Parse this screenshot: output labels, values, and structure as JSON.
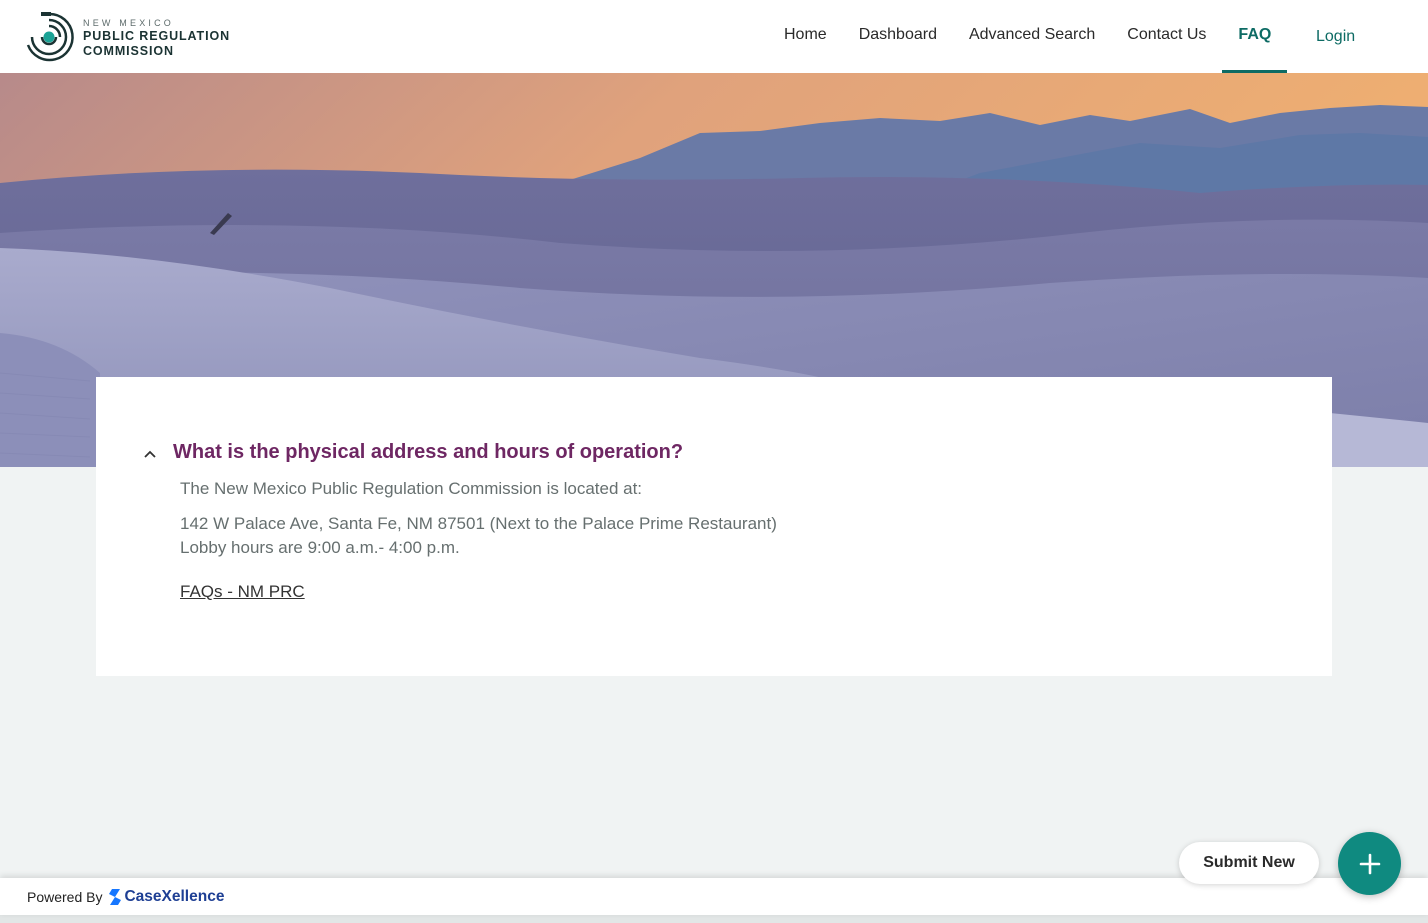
{
  "brand": {
    "line1": "NEW MEXICO",
    "line2": "PUBLIC REGULATION",
    "line3": "COMMISSION"
  },
  "nav": {
    "items": [
      {
        "label": "Home"
      },
      {
        "label": "Dashboard"
      },
      {
        "label": "Advanced Search"
      },
      {
        "label": "Contact Us"
      },
      {
        "label": "FAQ"
      }
    ],
    "active": "FAQ",
    "login": "Login"
  },
  "faq": {
    "question": "What is the physical address and hours of operation?",
    "answer": {
      "intro": "The New Mexico Public Regulation Commission is located at:",
      "address": "142 W Palace Ave, Santa Fe, NM 87501 (Next to the Palace Prime Restaurant)",
      "hours": "Lobby hours are 9:00 a.m.- 4:00 p.m."
    },
    "link": "FAQs - NM PRC",
    "expanded": true
  },
  "footer": {
    "powered_by": "Powered By",
    "vendor": "CaseXellence"
  },
  "actions": {
    "submit_new": "Submit New"
  },
  "colors": {
    "accent": "#0d6b64",
    "question": "#6e2763",
    "fab": "#0f8a80",
    "vendor": "#1e3f94"
  }
}
